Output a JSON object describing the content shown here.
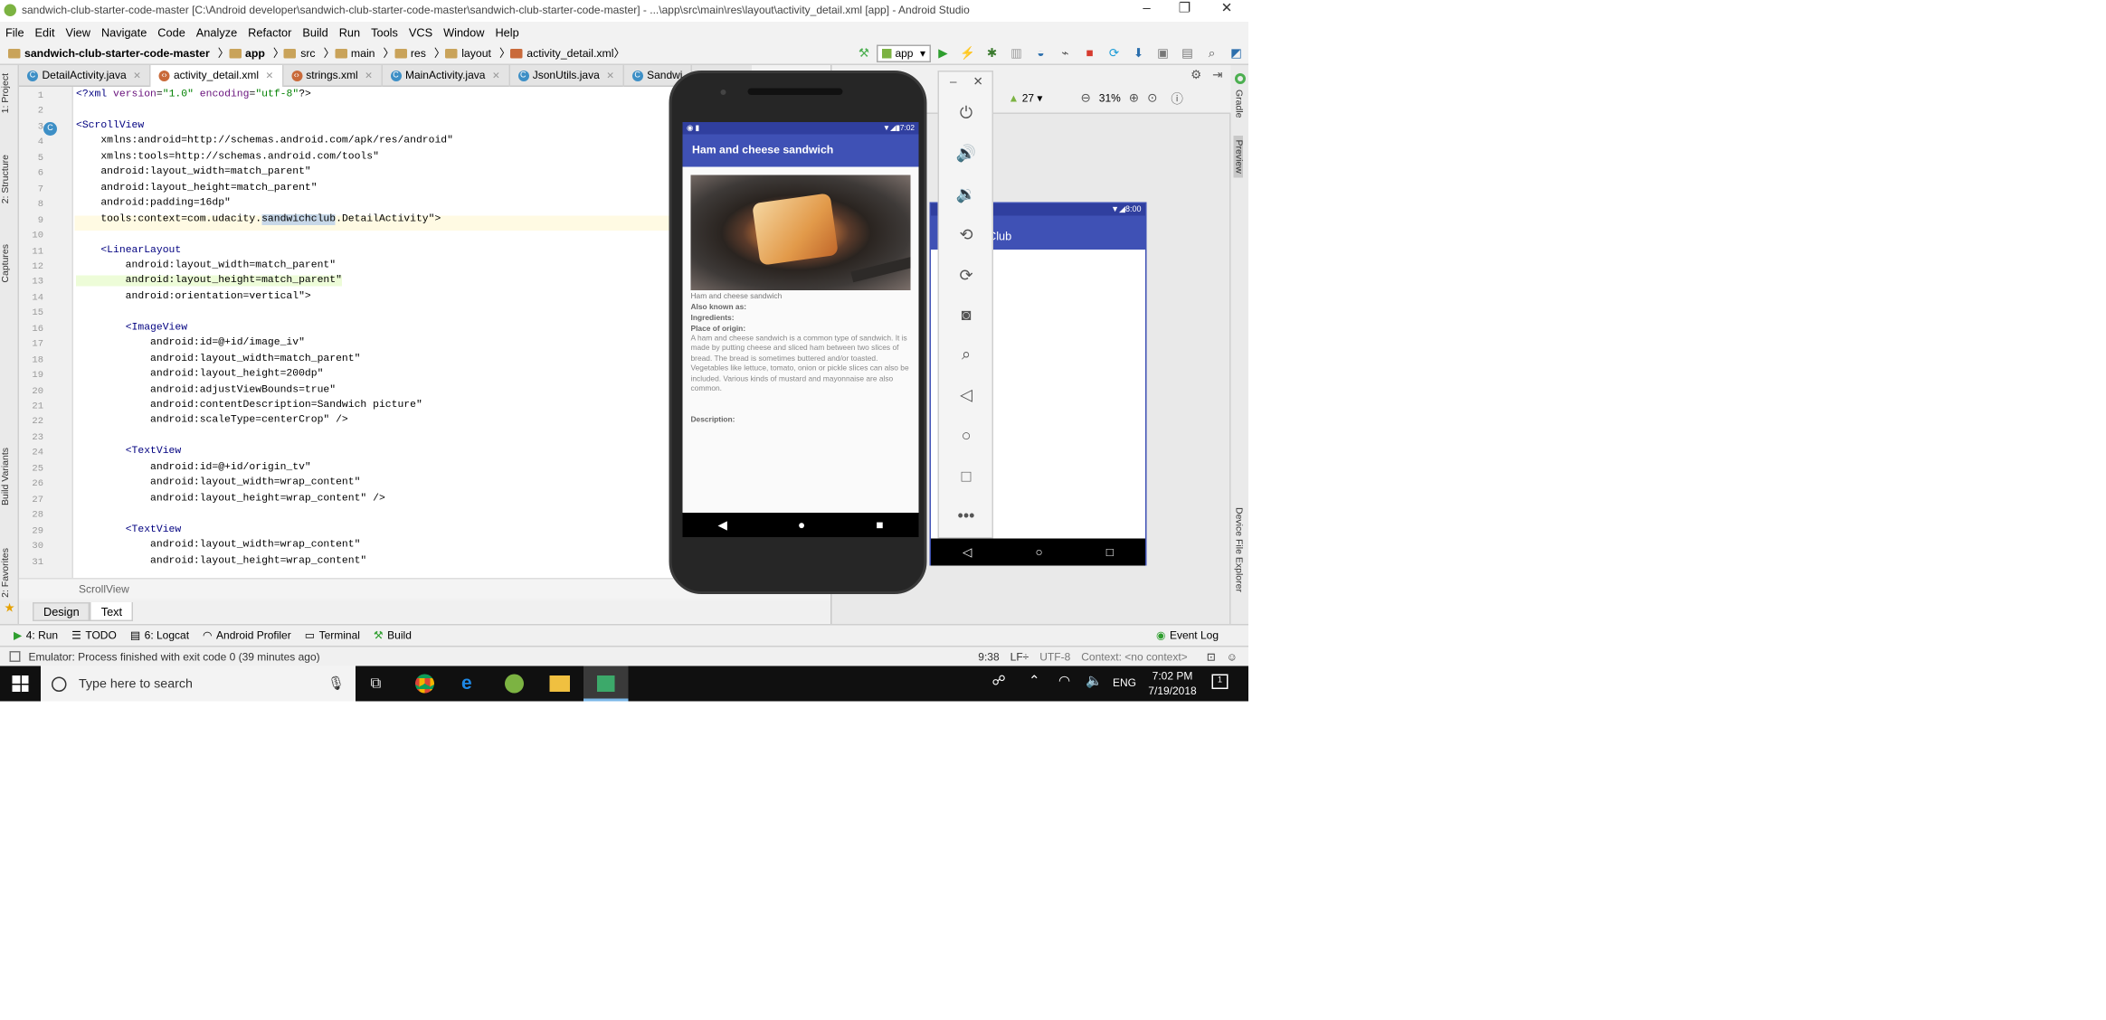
{
  "window": {
    "title": "sandwich-club-starter-code-master [C:\\Android developer\\sandwich-club-starter-code-master\\sandwich-club-starter-code-master] - ...\\app\\src\\main\\res\\layout\\activity_detail.xml [app] - Android Studio",
    "minimize": "–",
    "maximize": "❐",
    "close": "✕"
  },
  "menu": [
    "File",
    "Edit",
    "View",
    "Navigate",
    "Code",
    "Analyze",
    "Refactor",
    "Build",
    "Run",
    "Tools",
    "VCS",
    "Window",
    "Help"
  ],
  "breadcrumb": {
    "project": "sandwich-club-starter-code-master",
    "items": [
      "app",
      "src",
      "main",
      "res",
      "layout",
      "activity_detail.xml"
    ]
  },
  "toolbar": {
    "run_config": "app"
  },
  "left_tabs": [
    "1: Project",
    "2: Structure",
    "Captures",
    "Build Variants",
    "2: Favorites"
  ],
  "right_tabs": [
    "Gradle",
    "Preview",
    "Device File Explorer"
  ],
  "editor_tabs": [
    {
      "label": "DetailActivity.java",
      "active": false
    },
    {
      "label": "activity_detail.xml",
      "active": true
    },
    {
      "label": "strings.xml",
      "active": false
    },
    {
      "label": "MainActivity.java",
      "active": false
    },
    {
      "label": "JsonUtils.java",
      "active": false
    },
    {
      "label": "Sandwi",
      "active": false
    }
  ],
  "code_lines": [
    {
      "n": "1",
      "text": "<?xml version=\"1.0\" encoding=\"utf-8\"?>"
    },
    {
      "n": "2",
      "text": ""
    },
    {
      "n": "3",
      "text": "<ScrollView"
    },
    {
      "n": "4",
      "text": "    xmlns:android=\"http://schemas.android.com/apk/res/android\""
    },
    {
      "n": "5",
      "text": "    xmlns:tools=\"http://schemas.android.com/tools\""
    },
    {
      "n": "6",
      "text": "    android:layout_width=\"match_parent\""
    },
    {
      "n": "7",
      "text": "    android:layout_height=\"match_parent\""
    },
    {
      "n": "8",
      "text": "    android:padding=\"16dp\""
    },
    {
      "n": "9",
      "text": "    tools:context=\"com.udacity.sandwichclub.DetailActivity\">"
    },
    {
      "n": "10",
      "text": ""
    },
    {
      "n": "11",
      "text": "    <LinearLayout"
    },
    {
      "n": "12",
      "text": "        android:layout_width=\"match_parent\""
    },
    {
      "n": "13",
      "text": "        android:layout_height=\"match_parent\""
    },
    {
      "n": "14",
      "text": "        android:orientation=\"vertical\">"
    },
    {
      "n": "15",
      "text": ""
    },
    {
      "n": "16",
      "text": "        <ImageView"
    },
    {
      "n": "17",
      "text": "            android:id=\"@+id/image_iv\""
    },
    {
      "n": "18",
      "text": "            android:layout_width=\"match_parent\""
    },
    {
      "n": "19",
      "text": "            android:layout_height=\"200dp\""
    },
    {
      "n": "20",
      "text": "            android:adjustViewBounds=\"true\""
    },
    {
      "n": "21",
      "text": "            android:contentDescription=\"Sandwich picture\""
    },
    {
      "n": "22",
      "text": "            android:scaleType=\"centerCrop\" />"
    },
    {
      "n": "23",
      "text": ""
    },
    {
      "n": "24",
      "text": "        <TextView"
    },
    {
      "n": "25",
      "text": "            android:id=\"@+id/origin_tv\""
    },
    {
      "n": "26",
      "text": "            android:layout_width=\"wrap_content\""
    },
    {
      "n": "27",
      "text": "            android:layout_height=\"wrap_content\" />"
    },
    {
      "n": "28",
      "text": ""
    },
    {
      "n": "29",
      "text": "        <TextView"
    },
    {
      "n": "30",
      "text": "            android:layout_width=\"wrap_content\""
    },
    {
      "n": "31",
      "text": "            android:layout_height=\"wrap_content\""
    }
  ],
  "editor_footer": "ScrollView",
  "design_tabs": [
    "Design",
    "Text"
  ],
  "preview": {
    "api": "27",
    "zoom": "31%",
    "device_title": "Club",
    "device_time": "8:00"
  },
  "phone": {
    "time": "7:02",
    "app_title": "Ham and cheese sandwich",
    "image_caption": "Ham and cheese sandwich",
    "also_known_as": "Also known as:",
    "ingredients": "Ingredients:",
    "place_of_origin": "Place of origin:",
    "description_body": "A ham and cheese sandwich is a common type of sandwich. It is made by putting cheese and sliced ham between two slices of bread. The bread is sometimes buttered and/or toasted. Vegetables like lettuce, tomato, onion or pickle slices can also be included. Various kinds of mustard and mayonnaise are also common.",
    "description_label": "Description:"
  },
  "tool_windows": [
    "4: Run",
    "TODO",
    "6: Logcat",
    "Android Profiler",
    "Terminal",
    "Build"
  ],
  "event_log": "Event Log",
  "status": {
    "message": "Emulator: Process finished with exit code 0 (39 minutes ago)",
    "position": "9:38",
    "line_sep": "LF÷",
    "encoding": "UTF-8",
    "context": "Context: <no context>"
  },
  "taskbar": {
    "search_placeholder": "Type here to search",
    "language": "ENG",
    "time": "7:02 PM",
    "date": "7/19/2018",
    "notif": "1"
  }
}
